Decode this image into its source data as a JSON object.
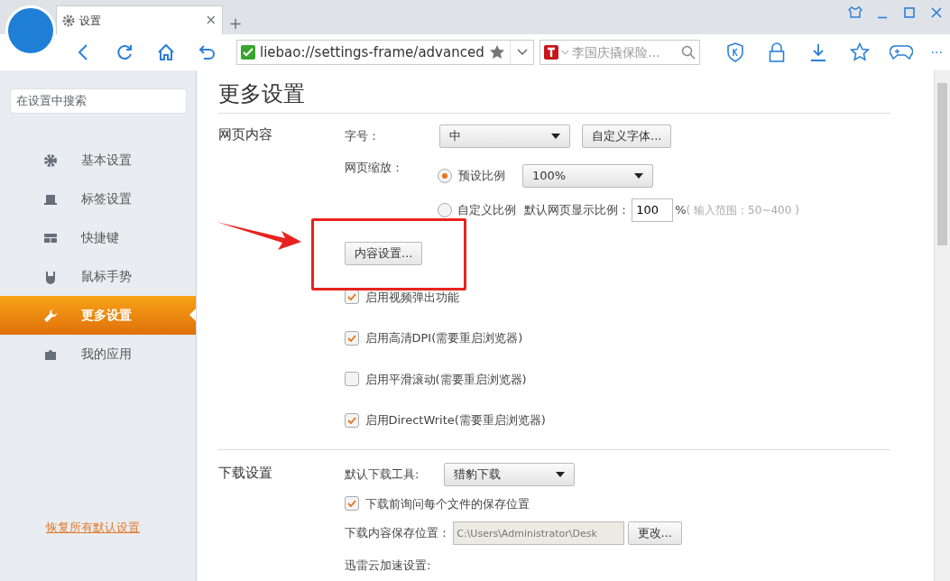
{
  "tab": {
    "title": "设置",
    "close": "×",
    "new_tab": "+"
  },
  "window_buttons": [
    {
      "kind": "skin"
    },
    {
      "kind": "min"
    },
    {
      "kind": "max"
    },
    {
      "kind": "close"
    }
  ],
  "address_bar": {
    "url": "liebao://settings-frame/advanced",
    "search_text": "李国庆撬保险...",
    "more": "···"
  },
  "sidebar": {
    "search_placeholder": "在设置中搜索",
    "items": [
      {
        "label": "基本设置",
        "selected": false
      },
      {
        "label": "标签设置",
        "selected": false
      },
      {
        "label": "快捷键",
        "selected": false
      },
      {
        "label": "鼠标手势",
        "selected": false
      },
      {
        "label": "更多设置",
        "selected": true
      },
      {
        "label": "我的应用",
        "selected": false
      }
    ],
    "reset_link": "恢复所有默认设置"
  },
  "page_title": "更多设置",
  "web_content": {
    "heading": "网页内容",
    "font_size_label": "字号：",
    "font_size_value": "中",
    "custom_font_button": "自定义字体...",
    "zoom_label": "网页缩放：",
    "zoom_options": [
      {
        "label": "预设比例",
        "selected": true
      },
      {
        "label": "自定义比例",
        "selected": false
      }
    ],
    "preset_value": "100%",
    "custom_label": "默认网页显示比例：",
    "custom_value": "100",
    "percent": "%",
    "range_hint": "( 输入范围：50~400 )",
    "content_settings_button": "内容设置...",
    "options": [
      {
        "label": "启用视频弹出功能",
        "checked": true
      },
      {
        "label": "启用高清DPI(需要重启浏览器)",
        "checked": true
      },
      {
        "label": "启用平滑滚动(需要重启浏览器)",
        "checked": false
      },
      {
        "label": "启用DirectWrite(需要重启浏览器)",
        "checked": true
      }
    ]
  },
  "download": {
    "heading": "下载设置",
    "tool_label": "默认下载工具:",
    "tool_value": "猎豹下载",
    "ask_option": {
      "label": "下载前询问每个文件的保存位置",
      "checked": true
    },
    "location_label": "下载内容保存位置：",
    "location_value": "C:\\Users\\Administrator\\Desk",
    "change_button": "更改...",
    "thunder_label": "迅雷云加速设置:"
  }
}
